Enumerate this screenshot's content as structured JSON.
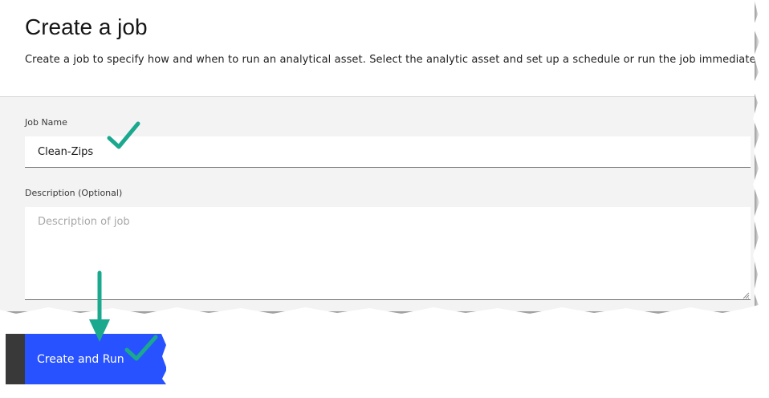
{
  "header": {
    "title": "Create a job",
    "subtitle": "Create a job to specify how and when to run an analytical asset. Select the analytic asset and set up a schedule or run the job immediately."
  },
  "form": {
    "job_name": {
      "label": "Job Name",
      "value": "Clean-Zips"
    },
    "description": {
      "label": "Description (Optional)",
      "value": "",
      "placeholder": "Description of job"
    }
  },
  "actions": {
    "create_run_label": "Create and Run"
  },
  "annotations": {
    "color": "#1aa88e",
    "icons": [
      "checkmark-icon",
      "down-arrow-icon"
    ]
  },
  "colors": {
    "primary_button": "#2852ff",
    "secondary_strip": "#393939",
    "form_background": "#f3f3f3"
  }
}
